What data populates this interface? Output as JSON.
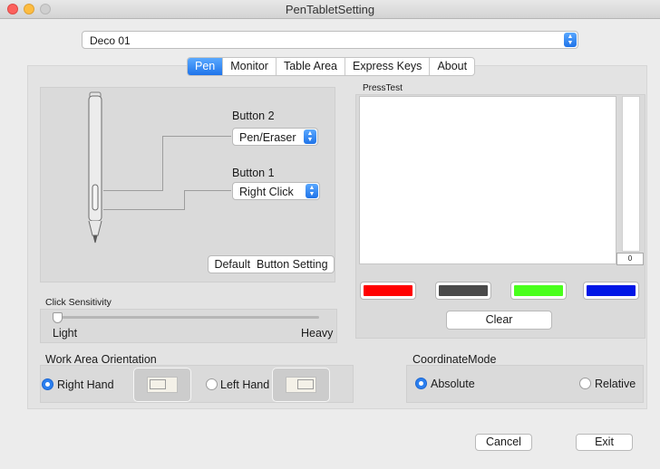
{
  "window": {
    "title": "PenTabletSetting"
  },
  "device": {
    "selected": "Deco 01"
  },
  "tabs": [
    {
      "label": "Pen",
      "active": true
    },
    {
      "label": "Monitor",
      "active": false
    },
    {
      "label": "Table Area",
      "active": false
    },
    {
      "label": "Express Keys",
      "active": false
    },
    {
      "label": "About",
      "active": false
    }
  ],
  "pen": {
    "button2_label": "Button 2",
    "button2_value": "Pen/Eraser",
    "button1_label": "Button 1",
    "button1_value": "Right Click",
    "default_button": "Default  Button Setting"
  },
  "sensitivity": {
    "label": "Click Sensitivity",
    "min_label": "Light",
    "max_label": "Heavy",
    "level": 0
  },
  "presstest": {
    "label": "PressTest",
    "pressure_value": "0",
    "colors": [
      "#ff0000",
      "#4a4a4a",
      "#49ff1c",
      "#0016e6"
    ],
    "clear_label": "Clear"
  },
  "orientation": {
    "label": "Work Area Orientation",
    "right_label": "Right Hand",
    "left_label": "Left Hand",
    "selected": "right"
  },
  "coordinate": {
    "label": "CoordinateMode",
    "absolute_label": "Absolute",
    "relative_label": "Relative",
    "selected": "absolute"
  },
  "footer": {
    "cancel_label": "Cancel",
    "exit_label": "Exit"
  }
}
